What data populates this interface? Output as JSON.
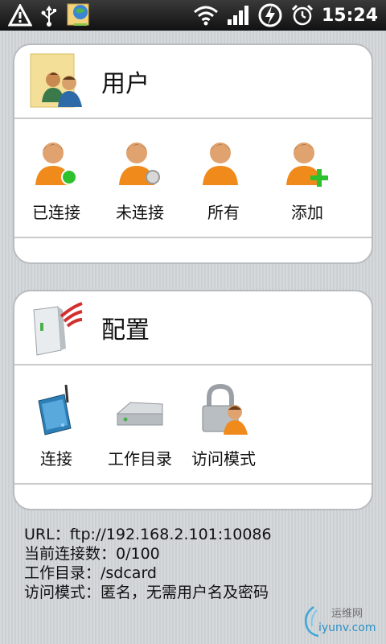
{
  "status_bar": {
    "time": "15:24",
    "icons": [
      "warning-icon",
      "usb-icon",
      "ftp-server-icon",
      "wifi-icon",
      "signal-icon",
      "battery-charging-icon",
      "alarm-icon"
    ]
  },
  "users_card": {
    "title": "用户",
    "items": [
      {
        "label": "已连接",
        "icon": "user-connected-icon"
      },
      {
        "label": "未连接",
        "icon": "user-disconnected-icon"
      },
      {
        "label": "所有",
        "icon": "user-all-icon"
      },
      {
        "label": "添加",
        "icon": "user-add-icon"
      }
    ]
  },
  "config_card": {
    "title": "配置",
    "items": [
      {
        "label": "连接",
        "icon": "router-icon"
      },
      {
        "label": "工作目录",
        "icon": "drive-icon"
      },
      {
        "label": "访问模式",
        "icon": "lock-user-icon"
      }
    ]
  },
  "info": {
    "url": "URL：ftp://192.168.2.101:10086",
    "connections": "当前连接数：0/100",
    "work_dir": "工作目录：/sdcard",
    "access_mode": "访问模式：匿名，无需用户名及密码"
  },
  "watermark": {
    "text_cn": "运维网",
    "text_en": "iyunv.com"
  },
  "colors": {
    "accent_green": "#2ec12e",
    "orange_shirt": "#f08a1a",
    "card_border": "#b9bcbf"
  }
}
